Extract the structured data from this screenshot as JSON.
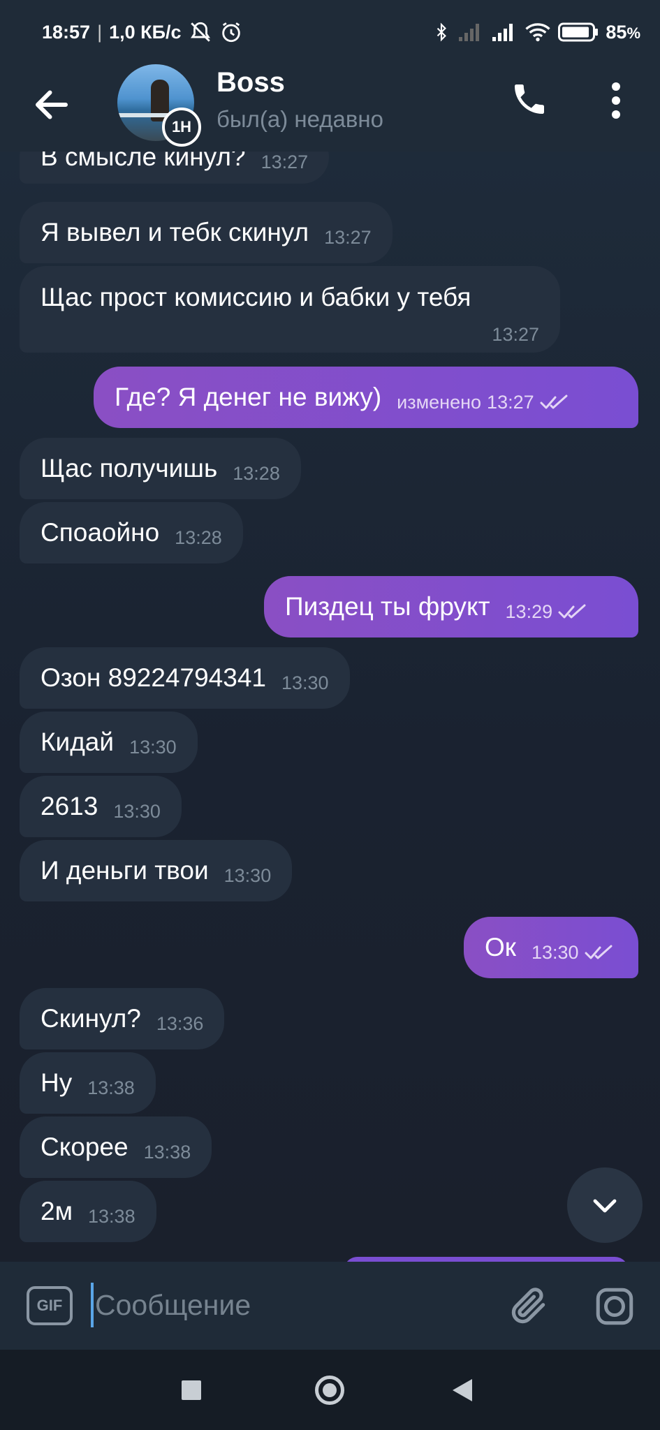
{
  "status_bar": {
    "time": "18:57",
    "network_speed": "1,0 КБ/с",
    "battery": "85",
    "battery_suffix": "%"
  },
  "header": {
    "title": "Boss",
    "status": "был(а) недавно",
    "timer_badge": "1Н"
  },
  "messages": [
    {
      "dir": "in",
      "text": "В смысле кинул?",
      "time": "13:27"
    },
    {
      "dir": "in",
      "text": "Я вывел и тебк скинул",
      "time": "13:27"
    },
    {
      "dir": "in",
      "text": "Щас прост комиссию и бабки у тебя",
      "time": "13:27"
    },
    {
      "dir": "out",
      "text": "Где? Я денег не вижу)",
      "edited": "изменено",
      "time": "13:27",
      "read": true
    },
    {
      "dir": "in",
      "text": "Щас получишь",
      "time": "13:28"
    },
    {
      "dir": "in",
      "text": "Споаойно",
      "time": "13:28"
    },
    {
      "dir": "out",
      "text": "Пиздец ты фрукт",
      "time": "13:29",
      "read": true
    },
    {
      "dir": "in",
      "text": "Озон 89224794341",
      "time": "13:30"
    },
    {
      "dir": "in",
      "text": "Кидай",
      "time": "13:30"
    },
    {
      "dir": "in",
      "text": "2613",
      "time": "13:30"
    },
    {
      "dir": "in",
      "text": "И деньги твои",
      "time": "13:30"
    },
    {
      "dir": "out",
      "text": "Ок",
      "time": "13:30",
      "read": true
    },
    {
      "dir": "in",
      "text": "Скинул?",
      "time": "13:36"
    },
    {
      "dir": "in",
      "text": "Ну",
      "time": "13:38"
    },
    {
      "dir": "in",
      "text": "Скорее",
      "time": "13:38"
    },
    {
      "dir": "in",
      "text": "2м",
      "time": "13:38"
    }
  ],
  "input": {
    "placeholder": "Сообщение",
    "gif_label": "GIF"
  },
  "icons": {
    "back": "arrow-left-icon",
    "call": "phone-icon",
    "menu": "more-vert-icon",
    "scroll_down": "chevron-down-icon",
    "attach": "paperclip-icon",
    "camera": "instagram-camera-icon"
  },
  "colors": {
    "incoming_bubble": "#25303f",
    "outgoing_bubble": "#7a4ed2",
    "background": "#1b2434",
    "header": "#1f2b38"
  }
}
